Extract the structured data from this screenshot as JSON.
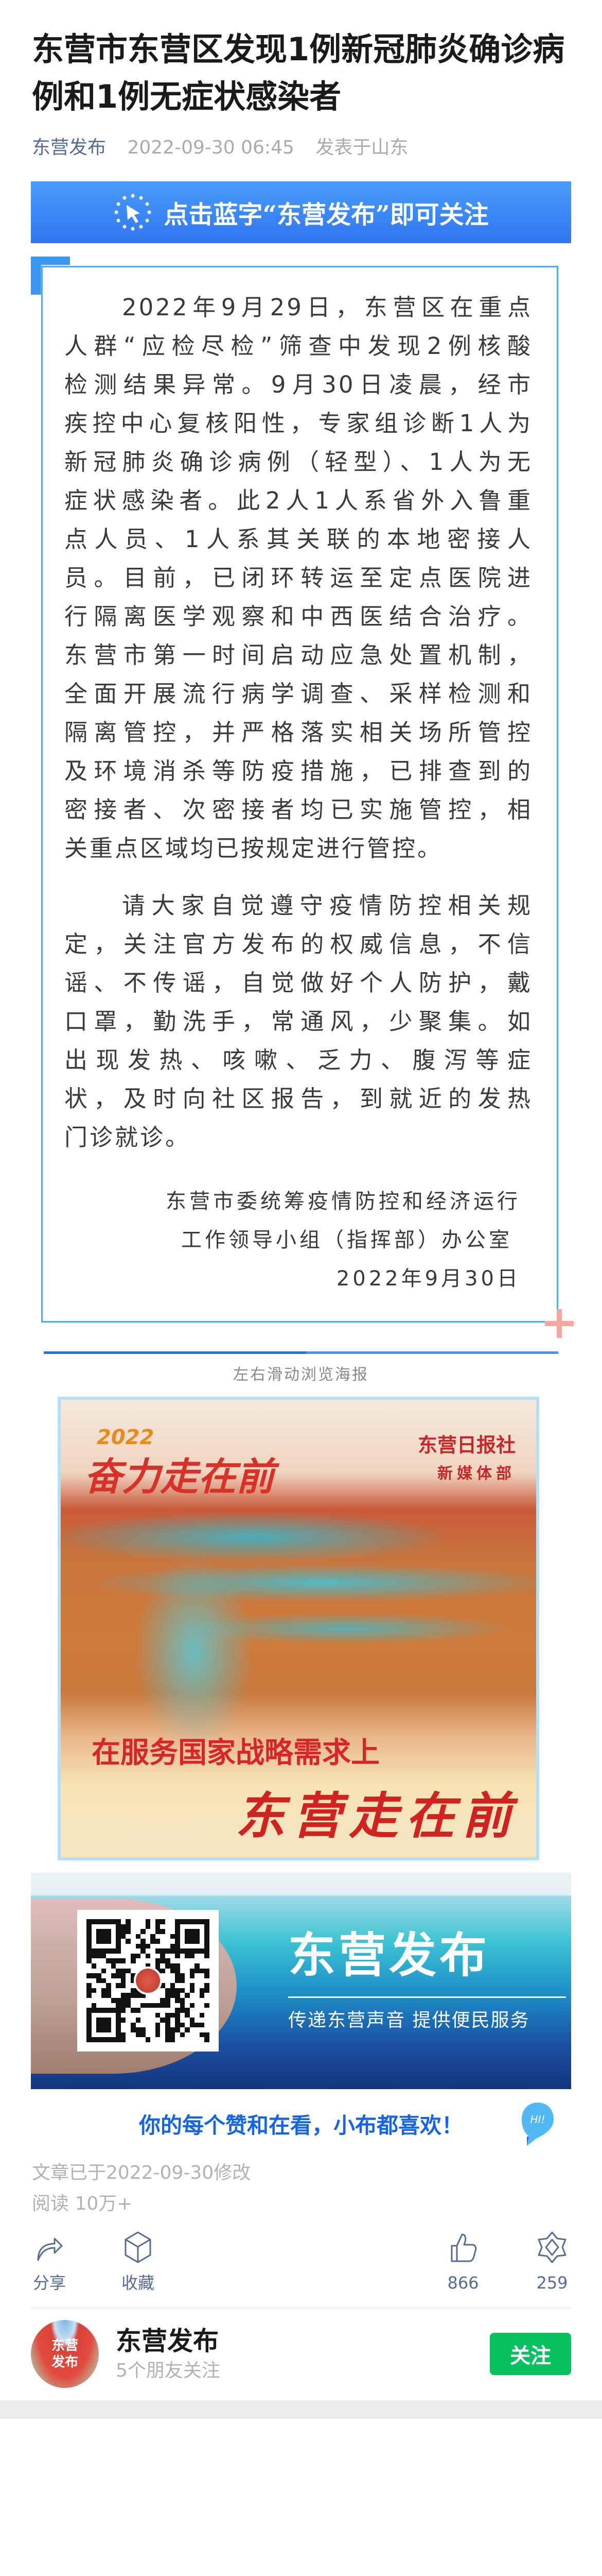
{
  "article": {
    "title": "东营市东营区发现1例新冠肺炎确诊病例和1例无症状感染者",
    "account": "东营发布",
    "datetime": "2022-09-30 06:45",
    "location": "发表于山东"
  },
  "follow_banner": {
    "text": "点击蓝字“东营发布”即可关注",
    "icon": "cursor-click-icon"
  },
  "body": {
    "para1": [
      "2022年9月29日，东营区在重点",
      "人群“应检尽检”筛查中发现2例核酸",
      "检测结果异常。9月30日凌晨，经市",
      "疾控中心复核阳性，专家组诊断1人为",
      "新冠肺炎确诊病例（轻型）、1人为无",
      "症状感染者。此2人1人系省外入鲁重",
      "点人员、1人系其关联的本地密接人",
      "员。目前，已闭环转运至定点医院进",
      "行隔离医学观察和中西医结合治疗。",
      "东营市第一时间启动应急处置机制，",
      "全面开展流行病学调查、采样检测和",
      "隔离管控，并严格落实相关场所管控",
      "及环境消杀等防疫措施，已排查到的",
      "密接者、次密接者均已实施管控，相",
      "关重点区域均已按规定进行管控。"
    ],
    "para2": [
      "请大家自觉遵守疫情防控相关规",
      "定，关注官方发布的权威信息，不信",
      "谣、不传谣，自觉做好个人防护，戴",
      "口罩，勤洗手，常通风，少聚集。如",
      "出现发热、咳嗽、乏力、腹泻等症",
      "状，及时向社区报告，到就近的发热",
      "门诊就诊。"
    ],
    "signature": [
      "东营市委统筹疫情防控和经济运行",
      "工作领导小组（指挥部）办公室",
      "2022年9月30日"
    ]
  },
  "swipe_hint": "左右滑动浏览海报",
  "poster": {
    "year": "2022",
    "headline": "奋力走在前",
    "publisher": "东营日报社",
    "department": "新媒体部",
    "subtitle": "在服务国家战略需求上",
    "slogan": "东营走在前"
  },
  "qr_banner": {
    "name": "东营发布",
    "slogan": "传递东营声音  提供便民服务"
  },
  "cta": {
    "text": "你的每个赞和在看，小布都喜欢！",
    "bubble": "HI!"
  },
  "stats": {
    "modified": "文章已于2022-09-30修改",
    "reads": "阅读 10万+"
  },
  "actions": [
    {
      "label": "分享",
      "icon": "share-icon"
    },
    {
      "label": "收藏",
      "icon": "collect-icon"
    },
    {
      "label": "866",
      "icon": "thumbs-up-icon"
    },
    {
      "label": "259",
      "icon": "wow-icon"
    }
  ],
  "author": {
    "name": "东营发布",
    "friends": "5个朋友关注",
    "follow": "关注",
    "avatar_text": "东营发布"
  },
  "colors": {
    "accent": "#576b95",
    "banner": "#3a86f5",
    "follow": "#07c160",
    "cta": "#1464e6"
  }
}
